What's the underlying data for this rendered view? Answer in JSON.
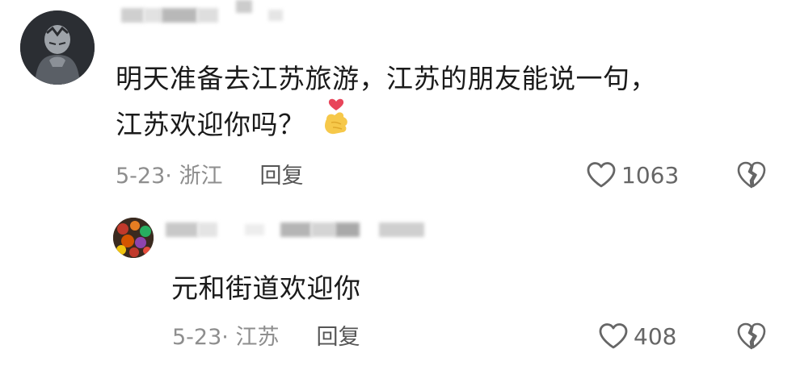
{
  "comment": {
    "text_line1": "明天准备去江苏旅游，江苏的朋友能说一句，",
    "text_line2": "江苏欢迎你吗？",
    "emoji": "heart-hand-emoji",
    "date_location": "5-23· 浙江",
    "reply_label": "回复",
    "like_count": "1063"
  },
  "reply": {
    "text": "元和街道欢迎你",
    "date_location": "5-23· 江苏",
    "reply_label": "回复",
    "like_count": "408"
  },
  "colors": {
    "text": "#1a1a1a",
    "meta": "#8e8e8e",
    "icon": "#666666",
    "heart_emoji": "#e8455a",
    "hand_emoji": "#f6c84a"
  },
  "icons": {
    "like": "heart-outline-icon",
    "dislike": "broken-heart-icon"
  }
}
